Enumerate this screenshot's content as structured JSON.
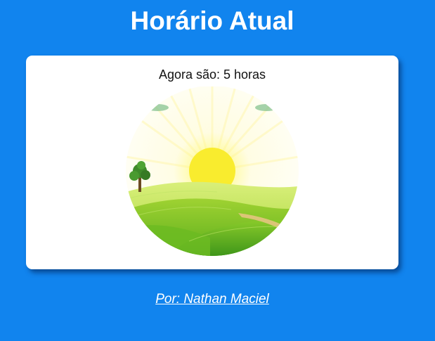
{
  "header": {
    "title": "Horário Atual"
  },
  "card": {
    "hour_text": "Agora são: 5 horas",
    "image": {
      "icon": "sunrise-landscape-illustration"
    }
  },
  "footer": {
    "credit": "Por: Nathan Maciel"
  },
  "colors": {
    "background": "#1184ee",
    "card": "#ffffff",
    "sun": "#f7e83a",
    "grass": "#7cc72a"
  }
}
